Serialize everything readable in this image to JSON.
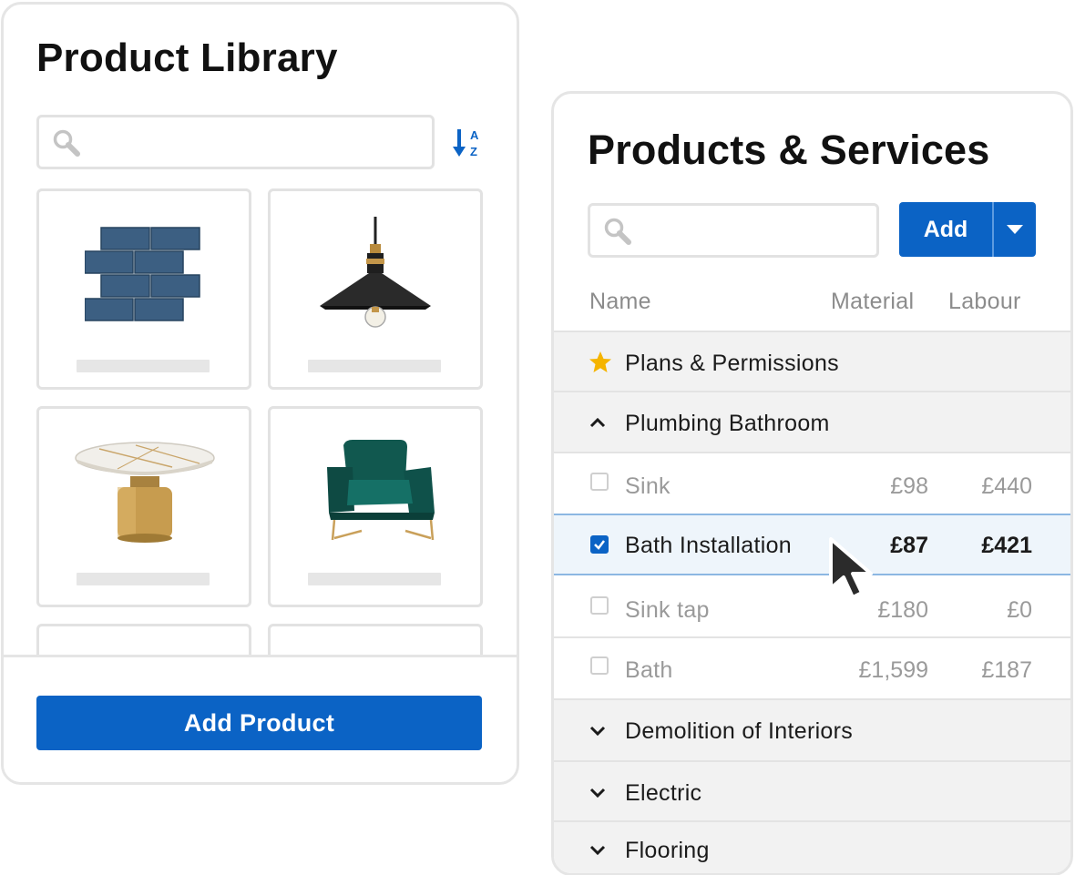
{
  "library": {
    "title": "Product Library",
    "search_placeholder": "",
    "sort_icon": "sort-a-z-icon",
    "products": [
      {
        "name": "subway-tile-image"
      },
      {
        "name": "pendant-lamp-image"
      },
      {
        "name": "marble-table-image"
      },
      {
        "name": "green-armchair-image"
      }
    ],
    "add_button": "Add Product"
  },
  "services": {
    "title": "Products & Services",
    "search_placeholder": "",
    "add_button": "Add",
    "columns": {
      "name": "Name",
      "material": "Material",
      "labour": "Labour"
    },
    "rows": [
      {
        "type": "group",
        "icon": "star-icon",
        "label": "Plans & Permissions"
      },
      {
        "type": "group",
        "icon": "chevron-up-icon",
        "label": "Plumbing Bathroom"
      },
      {
        "type": "item",
        "checked": false,
        "label": "Sink",
        "material": "£98",
        "labour": "£440"
      },
      {
        "type": "item",
        "checked": true,
        "label": "Bath Installation",
        "material": "£87",
        "labour": "£421"
      },
      {
        "type": "item",
        "checked": false,
        "label": "Sink tap",
        "material": "£180",
        "labour": "£0"
      },
      {
        "type": "item",
        "checked": false,
        "label": "Bath",
        "material": "£1,599",
        "labour": "£187"
      },
      {
        "type": "group",
        "icon": "chevron-down-icon",
        "label": "Demolition of Interiors"
      },
      {
        "type": "group",
        "icon": "chevron-down-icon",
        "label": "Electric"
      },
      {
        "type": "group",
        "icon": "chevron-down-icon",
        "label": "Flooring"
      }
    ]
  },
  "colors": {
    "accent": "#0b63c5",
    "star": "#f5b400",
    "border": "#e5e5e5"
  }
}
